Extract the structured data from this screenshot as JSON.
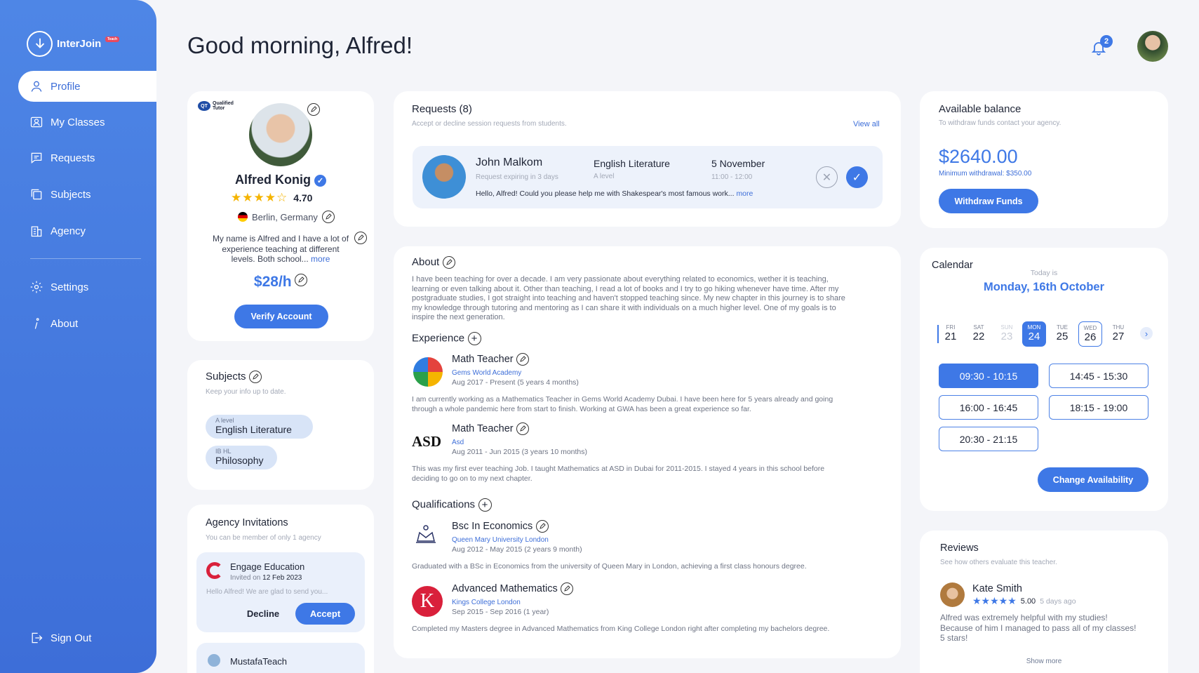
{
  "brand": {
    "name": "InterJoin",
    "tag": "Teach"
  },
  "nav": {
    "items": [
      {
        "label": "Profile",
        "icon": "user-icon"
      },
      {
        "label": "My Classes",
        "icon": "classes-icon"
      },
      {
        "label": "Requests",
        "icon": "chat-icon"
      },
      {
        "label": "Subjects",
        "icon": "copy-icon"
      },
      {
        "label": "Agency",
        "icon": "building-icon"
      },
      {
        "label": "Settings",
        "icon": "gear-icon"
      },
      {
        "label": "About",
        "icon": "info-icon"
      }
    ],
    "signout": "Sign Out"
  },
  "header": {
    "greeting": "Good morning, Alfred!",
    "notifications": "2"
  },
  "profile": {
    "badge": "Qualified Tutor",
    "badge_short": "QT",
    "name": "Alfred Konig",
    "rating": "4.70",
    "location": "Berlin, Germany",
    "bio": "My name is Alfred and I have a lot of experience teaching at different levels. Both school...",
    "bio_more": "more",
    "rate": "$28/h",
    "verify": "Verify Account"
  },
  "subjects": {
    "title": "Subjects",
    "subtitle": "Keep your info up to date.",
    "items": [
      {
        "level": "A level",
        "name": "English Literature"
      },
      {
        "level": "IB HL",
        "name": "Philosophy"
      }
    ]
  },
  "agency": {
    "title": "Agency Invitations",
    "subtitle": "You can be member of only 1 agency",
    "invite": {
      "name": "Engage Education",
      "invited_label": "Invited on",
      "date": "12 Feb 2023",
      "message": "Hello Alfred! We are glad to send you...",
      "decline": "Decline",
      "accept": "Accept"
    },
    "invite2": {
      "name": "MustafaTeach"
    }
  },
  "requests": {
    "title": "Requests (8)",
    "subtitle": "Accept or decline session requests from students.",
    "view_all": "View all",
    "item": {
      "name": "John Malkom",
      "expiry": "Request expiring in 3 days",
      "subject": "English Literature",
      "level": "A level",
      "date": "5 November",
      "time": "11:00 - 12:00",
      "message": "Hello, Alfred! Could you please help me with Shakespear's most famous work...",
      "more": "more"
    }
  },
  "about": {
    "title": "About",
    "text": "I have been teaching for over a decade. I am very passionate about everything related to economics, wether it is teaching, learning or even talking about it. Other than teaching, I read a lot of books and I try to go hiking whenever have time. After my postgraduate studies, I got straight into teaching and haven't stopped teaching since. My new chapter in this journey is to share my knowledge through tutoring and mentoring as I can share it with individuals on a much higher level. One of my goals is to inspire the next generation.",
    "experience_title": "Experience",
    "experience": [
      {
        "role": "Math Teacher",
        "org": "Gems World Academy",
        "period": "Aug 2017 - Present (5 years 4 months)",
        "desc": "I am currently working as a Mathematics Teacher in Gems World Academy Dubai. I have been here for 5 years already and going through a whole pandemic here from start to finish. Working at GWA has been a great experience so far."
      },
      {
        "role": "Math Teacher",
        "org": "Asd",
        "logo": "ASD",
        "period": "Aug 2011 - Jun 2015 (3 years 10 months)",
        "desc": "This was my first ever teaching Job. I taught Mathematics at ASD in Dubai for 2011-2015. I stayed 4 years in this school before deciding to go on to my next chapter."
      }
    ],
    "qualifications_title": "Qualifications",
    "qualifications": [
      {
        "degree": "Bsc In Economics",
        "org": "Queen Mary University London",
        "period": "Aug 2012 - May 2015 (2 years 9 month)",
        "desc": "Graduated with a BSc in Economics from the university of Queen Mary in London, achieving a first class honours degree."
      },
      {
        "degree": "Advanced Mathematics",
        "org": "Kings College London",
        "logo": "K",
        "period": "Sep 2015 - Sep 2016 (1 year)",
        "desc": "Completed my Masters degree in Advanced Mathematics from King College London right after completing my bachelors degree."
      }
    ]
  },
  "balance": {
    "title": "Available balance",
    "subtitle": "To withdraw funds contact your agency.",
    "amount": "$2640.00",
    "minimum": "Minimum withdrawal: $350.00",
    "button": "Withdraw Funds"
  },
  "calendar": {
    "title": "Calendar",
    "today_label": "Today is",
    "today": "Monday, 16th October",
    "days": [
      {
        "dn": "FRI",
        "dd": "21"
      },
      {
        "dn": "SAT",
        "dd": "22"
      },
      {
        "dn": "SUN",
        "dd": "23"
      },
      {
        "dn": "MON",
        "dd": "24"
      },
      {
        "dn": "TUE",
        "dd": "25"
      },
      {
        "dn": "WED",
        "dd": "26"
      },
      {
        "dn": "THU",
        "dd": "27"
      }
    ],
    "slots": [
      "09:30 - 10:15",
      "14:45 - 15:30",
      "16:00 - 16:45",
      "18:15 - 19:00",
      "20:30 - 21:15"
    ],
    "button": "Change Availability"
  },
  "reviews": {
    "title": "Reviews",
    "subtitle": "See how others evaluate this teacher.",
    "item": {
      "name": "Kate Smith",
      "rating": "5.00",
      "ago": "5 days ago",
      "text": "Alfred was extremely helpful with my studies! Because of him I managed to pass all of my classes! 5 stars!"
    },
    "more": "Show more"
  },
  "colors": {
    "accent": "#3E78E6",
    "sidebar": "#4A80E3",
    "background": "#F4F5F9"
  }
}
